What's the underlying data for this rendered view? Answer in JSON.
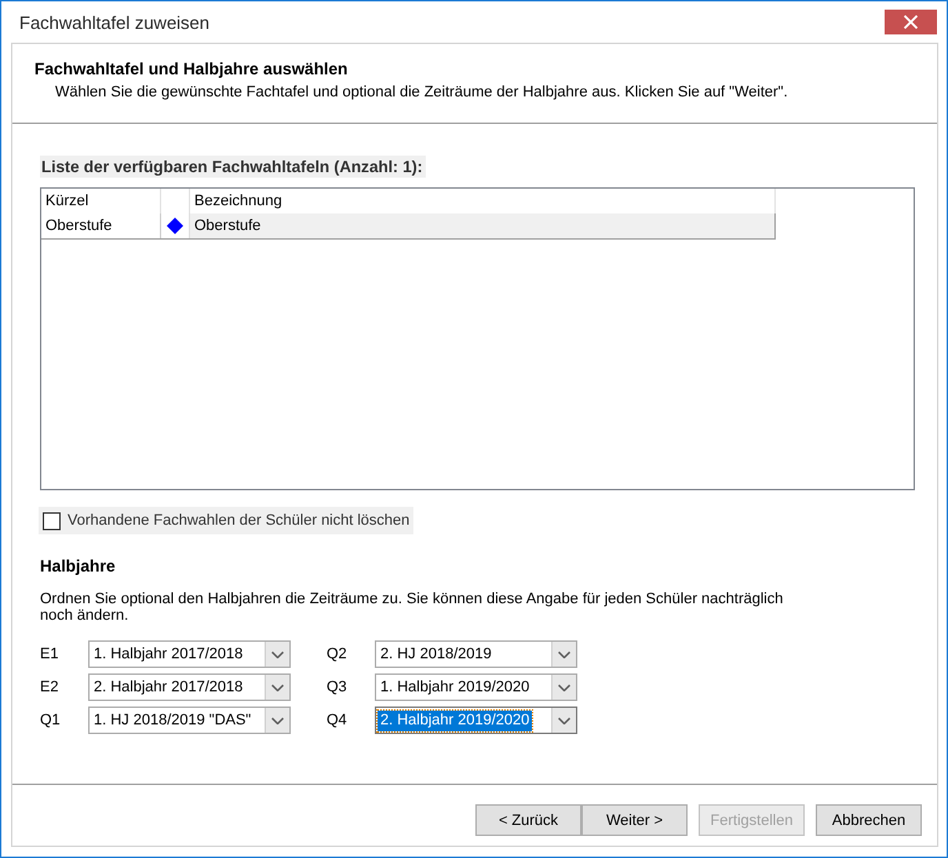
{
  "window": {
    "title": "Fachwahltafel zuweisen"
  },
  "header": {
    "title": "Fachwahltafel und Halbjahre auswählen",
    "description": "Wählen Sie die gewünschte Fachtafel und optional die Zeiträume der Halbjahre aus. Klicken Sie auf \"Weiter\"."
  },
  "table": {
    "caption": "Liste der verfügbaren Fachwahltafeln (Anzahl: 1):",
    "columns": [
      "Kürzel",
      "Bezeichnung"
    ],
    "rows": [
      {
        "kuerzel": "Oberstufe",
        "bezeichnung": "Oberstufe",
        "selected": true
      }
    ]
  },
  "keep_choices": {
    "label": "Vorhandene Fachwahlen der Schüler nicht löschen",
    "checked": false
  },
  "halbjahre": {
    "title": "Halbjahre",
    "description": "Ordnen Sie optional den Halbjahren die Zeiträume zu. Sie können diese Angabe für jeden Schüler nachträglich noch ändern.",
    "fields": [
      {
        "label": "E1",
        "value": "1. Halbjahr 2017/2018",
        "focused": false
      },
      {
        "label": "E2",
        "value": "2. Halbjahr 2017/2018",
        "focused": false
      },
      {
        "label": "Q1",
        "value": "1. HJ 2018/2019 \"DAS\"",
        "focused": false
      },
      {
        "label": "Q2",
        "value": "2. HJ 2018/2019",
        "focused": false
      },
      {
        "label": "Q3",
        "value": "1. Halbjahr 2019/2020",
        "focused": false
      },
      {
        "label": "Q4",
        "value": "2. Halbjahr 2019/2020",
        "focused": true
      }
    ]
  },
  "buttons": [
    {
      "label": "< Zurück",
      "disabled": false
    },
    {
      "label": "Weiter >",
      "disabled": false
    },
    {
      "label": "Fertigstellen",
      "disabled": true
    },
    {
      "label": "Abbrechen",
      "disabled": false
    }
  ]
}
